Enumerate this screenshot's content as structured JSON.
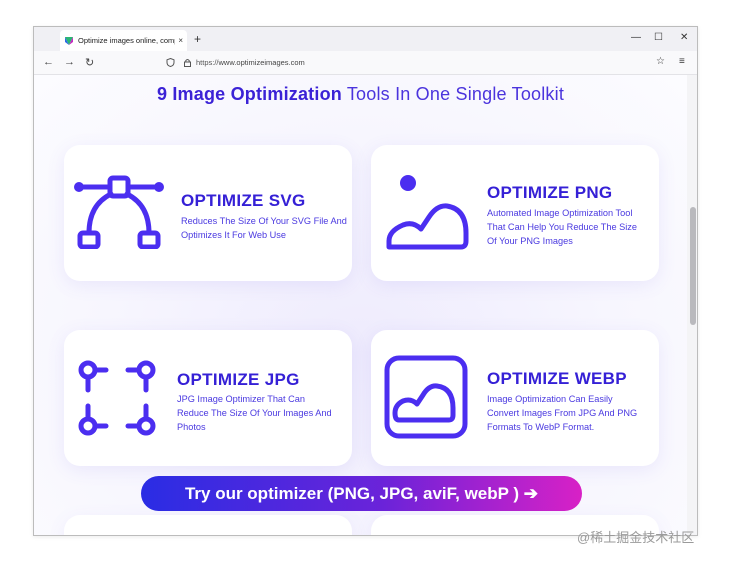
{
  "browser": {
    "tab_title": "Optimize images online, comp",
    "tab_close": "×",
    "new_tab": "+",
    "minimize": "—",
    "maximize": "☐",
    "close": "✕",
    "url_prefix": "https://",
    "url_host": "www.optimizeimages.com",
    "back": "←",
    "forward": "→",
    "reload": "↻",
    "star": "☆",
    "menu": "≡"
  },
  "page": {
    "heading_strong": "9 Image Optimization",
    "heading_rest": " Tools In One Single Toolkit",
    "cards": [
      {
        "title": "OPTIMIZE SVG",
        "desc": "Reduces The Size Of Your SVG File And Optimizes It For Web Use",
        "icon": "bezier-curve-icon"
      },
      {
        "title": "OPTIMIZE PNG",
        "desc": "Automated Image Optimization Tool That Can Help You Reduce The Size Of Your PNG Images",
        "icon": "image-landscape-icon"
      },
      {
        "title": "OPTIMIZE JPG",
        "desc": "JPG Image Optimizer That Can Reduce The Size Of Your Images And Photos",
        "icon": "crop-corners-icon"
      },
      {
        "title": "OPTIMIZE WEBP",
        "desc": "Image Optimization Can Easily Convert Images From JPG And PNG Formats To WebP Format.",
        "icon": "framed-image-icon"
      }
    ],
    "cta_label": "Try our optimizer (PNG, JPG, aviF, webP ) ➔"
  },
  "watermark": "@稀土掘金技术社区",
  "colors": {
    "accent": "#3520d6",
    "icon": "#4b2ef0",
    "cta_start": "#2a2de4",
    "cta_end": "#d821c6"
  }
}
